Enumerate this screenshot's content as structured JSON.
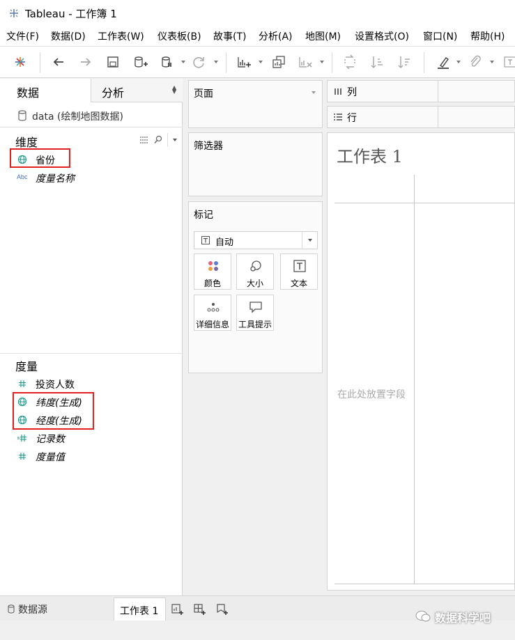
{
  "window": {
    "title": "Tableau - 工作簿 1"
  },
  "menu": [
    "文件(F)",
    "数据(D)",
    "工作表(W)",
    "仪表板(B)",
    "故事(T)",
    "分析(A)",
    "地图(M)",
    "设置格式(O)",
    "窗口(N)",
    "帮助(H)"
  ],
  "left_pane": {
    "tab_data": "数据",
    "tab_analysis": "分析",
    "datasource": "data (绘制地图数据)",
    "dimensions_title": "维度",
    "dimensions": [
      {
        "label": "省份",
        "icon": "globe-icon",
        "italic": false
      },
      {
        "label": "度量名称",
        "icon": "abc-icon",
        "italic": true
      }
    ],
    "measures_title": "度量",
    "measures": [
      {
        "label": "投资人数",
        "icon": "hash-icon",
        "italic": false
      },
      {
        "label": "纬度(生成)",
        "icon": "globe-icon",
        "italic": true
      },
      {
        "label": "经度(生成)",
        "icon": "globe-icon",
        "italic": true
      },
      {
        "label": "记录数",
        "icon": "hash-calc-icon",
        "italic": true
      },
      {
        "label": "度量值",
        "icon": "hash-icon",
        "italic": true
      }
    ],
    "abc_text": "Abc"
  },
  "shelves": {
    "pages": "页面",
    "filters": "筛选器",
    "marks": "标记",
    "mark_type": "自动",
    "mark_buttons": [
      "颜色",
      "大小",
      "文本",
      "详细信息",
      "工具提示"
    ],
    "columns": "列",
    "rows": "行"
  },
  "canvas": {
    "title": "工作表 1",
    "drop_hint": "在此处放置字段"
  },
  "bottom": {
    "datasource_tab": "数据源",
    "sheet_tab": "工作表 1"
  },
  "watermark": "数据科学吧",
  "colors": {
    "highlight_box": "#e02020",
    "globe": "#1a9a8a",
    "toolbar_icon": "#555555"
  }
}
